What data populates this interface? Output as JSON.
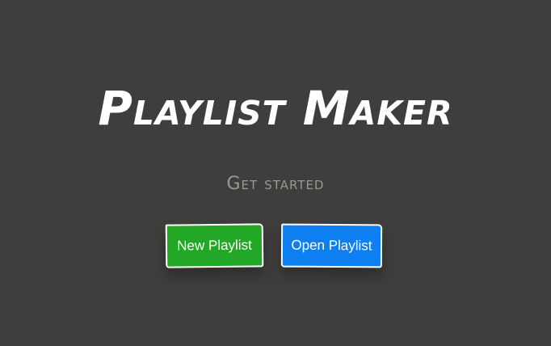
{
  "app": {
    "title": "Playlist Maker",
    "subtitle": "Get started"
  },
  "actions": {
    "new_playlist_label": "New Playlist",
    "open_playlist_label": "Open Playlist"
  },
  "colors": {
    "background": "#403e3c",
    "new_button": "#22a727",
    "open_button": "#0d7ff0",
    "title_text": "#ffffff",
    "subtitle_text": "#9a9895"
  }
}
